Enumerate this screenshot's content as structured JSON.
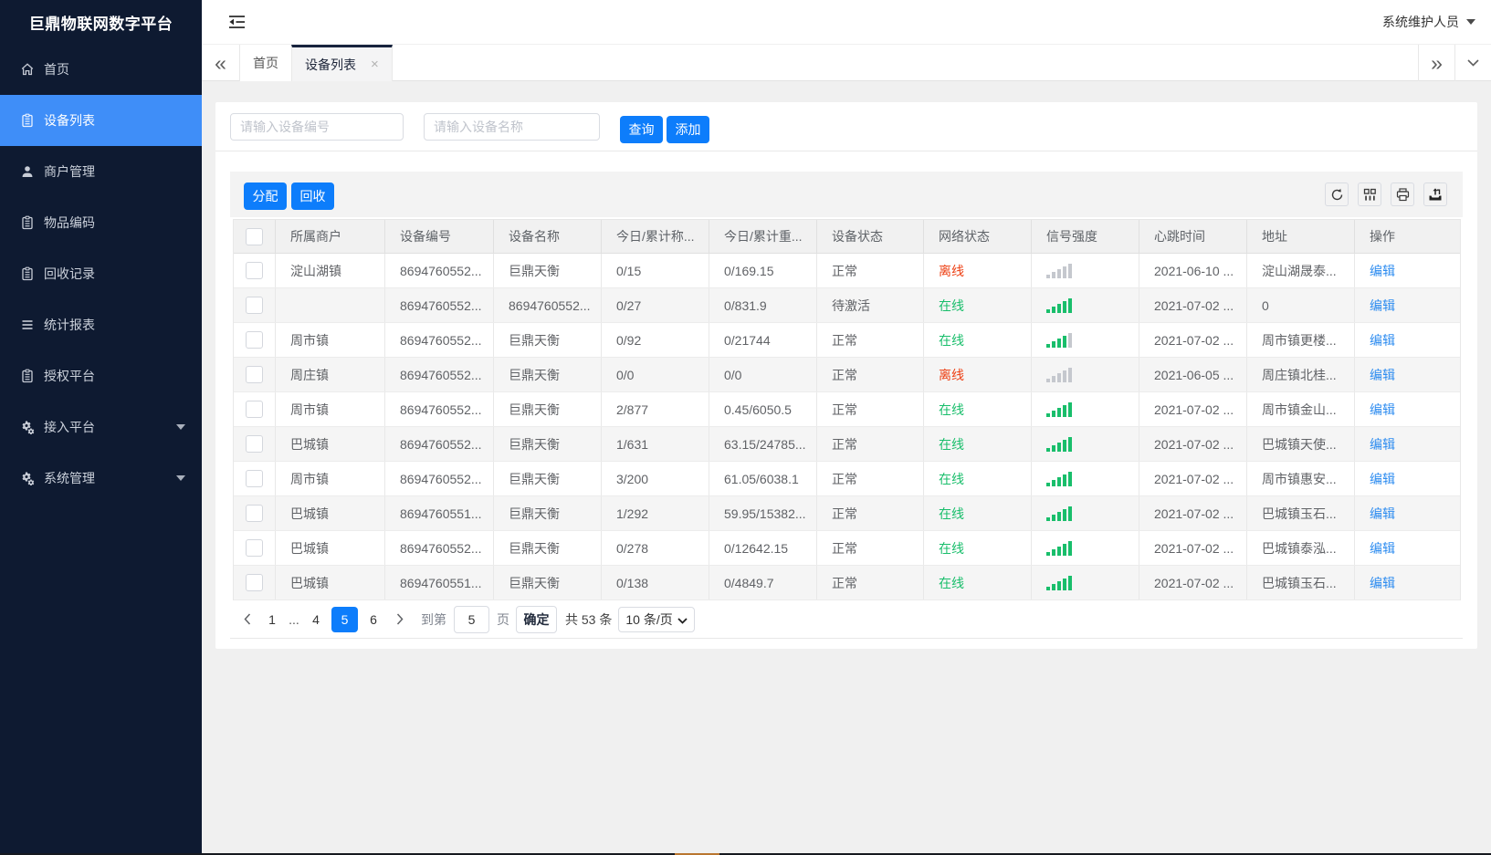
{
  "app": {
    "title": "巨鼎物联网数字平台",
    "user_menu": "系统维护人员"
  },
  "sidebar": {
    "items": [
      {
        "label": "首页",
        "icon": "home-icon",
        "active": false,
        "submenu": false
      },
      {
        "label": "设备列表",
        "icon": "list-icon",
        "active": true,
        "submenu": false
      },
      {
        "label": "商户管理",
        "icon": "user-icon",
        "active": false,
        "submenu": false
      },
      {
        "label": "物品编码",
        "icon": "doc-icon",
        "active": false,
        "submenu": false
      },
      {
        "label": "回收记录",
        "icon": "doc-icon",
        "active": false,
        "submenu": false
      },
      {
        "label": "统计报表",
        "icon": "bars-icon",
        "active": false,
        "submenu": false
      },
      {
        "label": "授权平台",
        "icon": "doc-icon",
        "active": false,
        "submenu": false
      },
      {
        "label": "接入平台",
        "icon": "gear-icon",
        "active": false,
        "submenu": true
      },
      {
        "label": "系统管理",
        "icon": "gear-icon",
        "active": false,
        "submenu": true
      }
    ]
  },
  "tabs": {
    "items": [
      {
        "label": "首页",
        "active": false,
        "closable": false
      },
      {
        "label": "设备列表",
        "active": true,
        "closable": true
      }
    ]
  },
  "search": {
    "device_no_placeholder": "请输入设备编号",
    "device_name_placeholder": "请输入设备名称",
    "query_label": "查询",
    "add_label": "添加"
  },
  "toolbar": {
    "assign_label": "分配",
    "recycle_label": "回收",
    "icons": [
      "refresh-icon",
      "columns-icon",
      "print-icon",
      "export-icon"
    ]
  },
  "table": {
    "columns": [
      "所属商户",
      "设备编号",
      "设备名称",
      "今日/累计称...",
      "今日/累计重...",
      "设备状态",
      "网络状态",
      "信号强度",
      "心跳时间",
      "地址",
      "操作"
    ],
    "edit_label": "编辑",
    "rows": [
      {
        "merchant": "淀山湖镇",
        "device_no": "8694760552...",
        "device_name": "巨鼎天衡",
        "today_count": "0/15",
        "today_weight": "0/169.15",
        "status": "正常",
        "network": "离线",
        "online": false,
        "signal": 0,
        "heartbeat": "2021-06-10 ...",
        "address": "淀山湖晟泰..."
      },
      {
        "merchant": "",
        "device_no": "8694760552...",
        "device_name": "8694760552...",
        "today_count": "0/27",
        "today_weight": "0/831.9",
        "status": "待激活",
        "network": "在线",
        "online": true,
        "signal": 5,
        "heartbeat": "2021-07-02 ...",
        "address": "0"
      },
      {
        "merchant": "周市镇",
        "device_no": "8694760552...",
        "device_name": "巨鼎天衡",
        "today_count": "0/92",
        "today_weight": "0/21744",
        "status": "正常",
        "network": "在线",
        "online": true,
        "signal": 4,
        "heartbeat": "2021-07-02 ...",
        "address": "周市镇更楼..."
      },
      {
        "merchant": "周庄镇",
        "device_no": "8694760552...",
        "device_name": "巨鼎天衡",
        "today_count": "0/0",
        "today_weight": "0/0",
        "status": "正常",
        "network": "离线",
        "online": false,
        "signal": 0,
        "heartbeat": "2021-06-05 ...",
        "address": "周庄镇北桂..."
      },
      {
        "merchant": "周市镇",
        "device_no": "8694760552...",
        "device_name": "巨鼎天衡",
        "today_count": "2/877",
        "today_weight": "0.45/6050.5",
        "status": "正常",
        "network": "在线",
        "online": true,
        "signal": 5,
        "heartbeat": "2021-07-02 ...",
        "address": "周市镇金山..."
      },
      {
        "merchant": "巴城镇",
        "device_no": "8694760552...",
        "device_name": "巨鼎天衡",
        "today_count": "1/631",
        "today_weight": "63.15/24785...",
        "status": "正常",
        "network": "在线",
        "online": true,
        "signal": 5,
        "heartbeat": "2021-07-02 ...",
        "address": "巴城镇天使..."
      },
      {
        "merchant": "周市镇",
        "device_no": "8694760552...",
        "device_name": "巨鼎天衡",
        "today_count": "3/200",
        "today_weight": "61.05/6038.1",
        "status": "正常",
        "network": "在线",
        "online": true,
        "signal": 5,
        "heartbeat": "2021-07-02 ...",
        "address": "周市镇惠安..."
      },
      {
        "merchant": "巴城镇",
        "device_no": "8694760551...",
        "device_name": "巨鼎天衡",
        "today_count": "1/292",
        "today_weight": "59.95/15382...",
        "status": "正常",
        "network": "在线",
        "online": true,
        "signal": 5,
        "heartbeat": "2021-07-02 ...",
        "address": "巴城镇玉石..."
      },
      {
        "merchant": "巴城镇",
        "device_no": "8694760552...",
        "device_name": "巨鼎天衡",
        "today_count": "0/278",
        "today_weight": "0/12642.15",
        "status": "正常",
        "network": "在线",
        "online": true,
        "signal": 5,
        "heartbeat": "2021-07-02 ...",
        "address": "巴城镇泰泓..."
      },
      {
        "merchant": "巴城镇",
        "device_no": "8694760551...",
        "device_name": "巨鼎天衡",
        "today_count": "0/138",
        "today_weight": "0/4849.7",
        "status": "正常",
        "network": "在线",
        "online": true,
        "signal": 5,
        "heartbeat": "2021-07-02 ...",
        "address": "巴城镇玉石..."
      }
    ]
  },
  "pagination": {
    "pages": [
      "1",
      "...",
      "4",
      "5",
      "6"
    ],
    "active_page": "5",
    "goto_label": "到第",
    "goto_value": "5",
    "page_word": "页",
    "confirm_label": "确定",
    "total_label": "共 53 条",
    "page_size_label": "10 条/页"
  },
  "colors": {
    "primary": "#0d7dfb",
    "sidebar_bg": "#0e1a31",
    "sidebar_active": "#3f8ef8",
    "online_green": "#19be6b",
    "offline_red": "#ed4014",
    "link_blue": "#2d8cf0"
  }
}
